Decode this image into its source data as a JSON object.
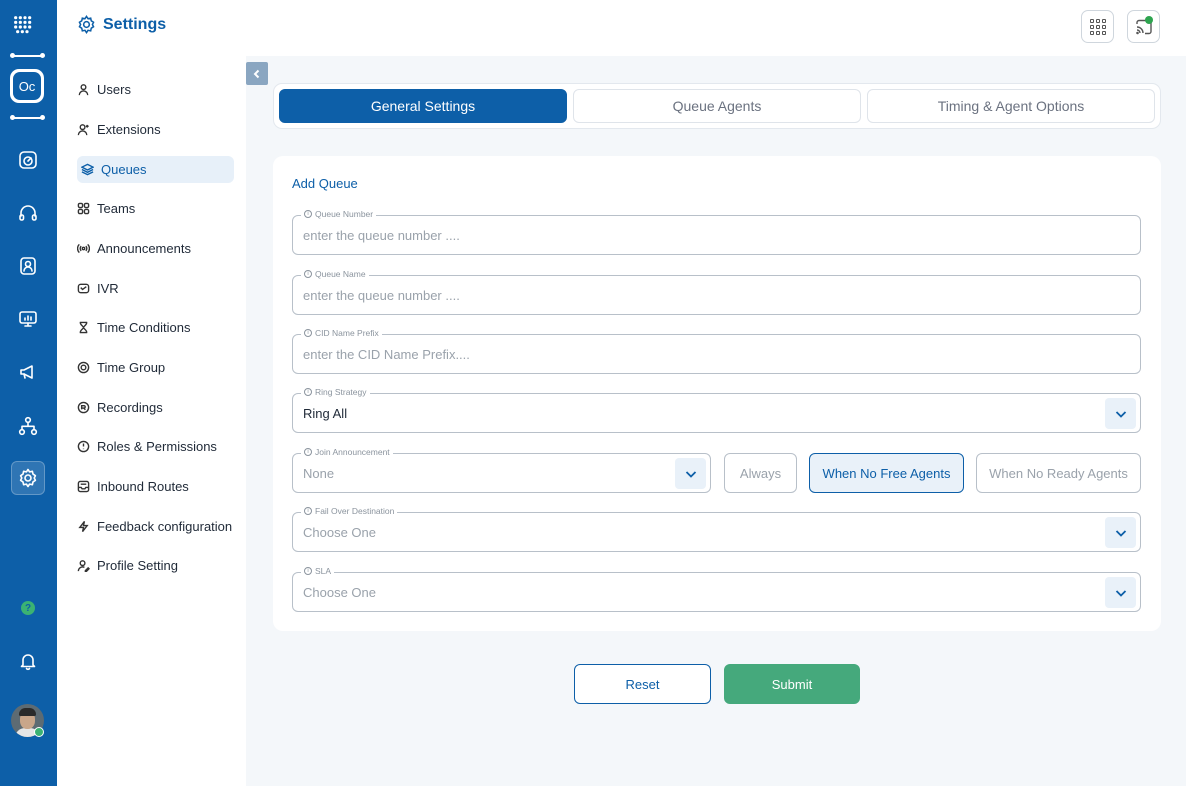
{
  "colors": {
    "brand": "#0d5fa8",
    "accent_green": "#45a97c",
    "active_tab_bg": "#0d5fa8"
  },
  "rail": {
    "logo_badge": "Oc",
    "icons": [
      "dashboard-icon",
      "headset-icon",
      "contacts-icon",
      "monitor-chart-icon",
      "megaphone-icon",
      "org-chart-icon",
      "settings-icon"
    ],
    "help_label": "?"
  },
  "sidebar": {
    "title": "Settings",
    "items": [
      {
        "label": "Users",
        "icon": "user-icon"
      },
      {
        "label": "Extensions",
        "icon": "user-plus-icon"
      },
      {
        "label": "Queues",
        "icon": "layers-icon",
        "active": true
      },
      {
        "label": "Teams",
        "icon": "grid-icon"
      },
      {
        "label": "Announcements",
        "icon": "broadcast-icon"
      },
      {
        "label": "IVR",
        "icon": "ivr-icon"
      },
      {
        "label": "Time Conditions",
        "icon": "hourglass-icon"
      },
      {
        "label": "Time Group",
        "icon": "target-icon"
      },
      {
        "label": "Recordings",
        "icon": "recording-icon"
      },
      {
        "label": "Roles & Permissions",
        "icon": "shield-icon"
      },
      {
        "label": "Inbound Routes",
        "icon": "inbox-icon"
      },
      {
        "label": "Feedback configuration",
        "icon": "bolt-icon"
      },
      {
        "label": "Profile Setting",
        "icon": "user-edit-icon"
      }
    ]
  },
  "tabs": [
    {
      "label": "General Settings",
      "active": true
    },
    {
      "label": "Queue Agents",
      "active": false
    },
    {
      "label": "Timing & Agent Options",
      "active": false
    }
  ],
  "form": {
    "title": "Add Queue",
    "queue_number": {
      "label": "Queue Number",
      "placeholder": "enter the queue number ...."
    },
    "queue_name": {
      "label": "Queue Name",
      "placeholder": "enter the queue number ...."
    },
    "cid_prefix": {
      "label": "CID Name Prefix",
      "placeholder": "enter the CID Name Prefix...."
    },
    "ring_strategy": {
      "label": "Ring Strategy",
      "value": "Ring All"
    },
    "join_announcement": {
      "label": "Join Announcement",
      "value": "None"
    },
    "announcement_options": [
      {
        "label": "Always",
        "active": false
      },
      {
        "label": "When No Free Agents",
        "active": true
      },
      {
        "label": "When No Ready Agents",
        "active": false
      }
    ],
    "fail_over": {
      "label": "Fail Over Destination",
      "value": "Choose One"
    },
    "sla": {
      "label": "SLA",
      "value": "Choose One"
    }
  },
  "actions": {
    "reset": "Reset",
    "submit": "Submit"
  }
}
